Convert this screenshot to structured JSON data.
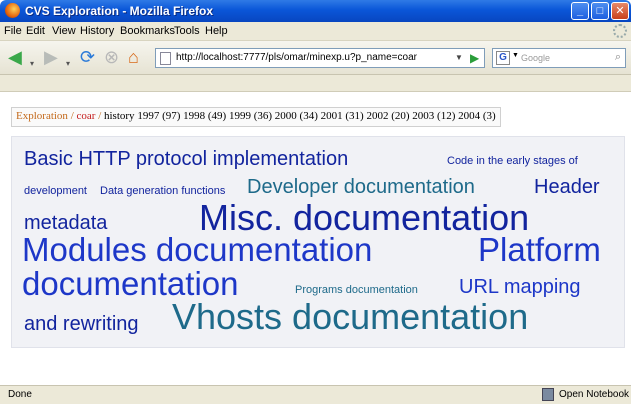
{
  "window": {
    "title": "CVS Exploration - Mozilla Firefox",
    "minimize": "_",
    "maximize": "□",
    "close": "✕"
  },
  "menu": [
    "File",
    "Edit",
    "View",
    "History",
    "Bookmarks",
    "Tools",
    "Help"
  ],
  "nav": {
    "url": "http://localhost:7777/pls/omar/minexp.u?p_name=coar",
    "search_placeholder": "Google",
    "search_engine_glyph": "G"
  },
  "breadcrumb": {
    "root": "Exploration",
    "separator": "/",
    "project": "coar",
    "history_label": "history",
    "years": [
      {
        "year": "1997",
        "count": "(97)"
      },
      {
        "year": "1998",
        "count": "(49)"
      },
      {
        "year": "1999",
        "count": "(36)"
      },
      {
        "year": "2000",
        "count": "(34)"
      },
      {
        "year": "2001",
        "count": "(31)"
      },
      {
        "year": "2002",
        "count": "(20)"
      },
      {
        "year": "2003",
        "count": "(12)"
      },
      {
        "year": "2004",
        "count": "(3)"
      }
    ]
  },
  "tagcloud": {
    "lines": [
      "Basic HTTP protocol implementation",
      "Code in the early stages of",
      "development",
      "Data generation functions",
      "Developer documentation",
      "Header",
      "metadata",
      "Misc. documentation",
      "Modules documentation",
      "Platform",
      "documentation",
      "Programs documentation",
      "URL mapping",
      "and rewriting",
      "Vhosts documentation"
    ]
  },
  "status": {
    "text": "Done",
    "notebook": "Open Notebook"
  },
  "colors": {
    "titlebar": "#0a56d8",
    "tag_navy": "#12249e",
    "tag_teal": "#1e6a8a",
    "tag_blue": "#1d37c8",
    "breadcrumb_link": "#c46a1c"
  }
}
